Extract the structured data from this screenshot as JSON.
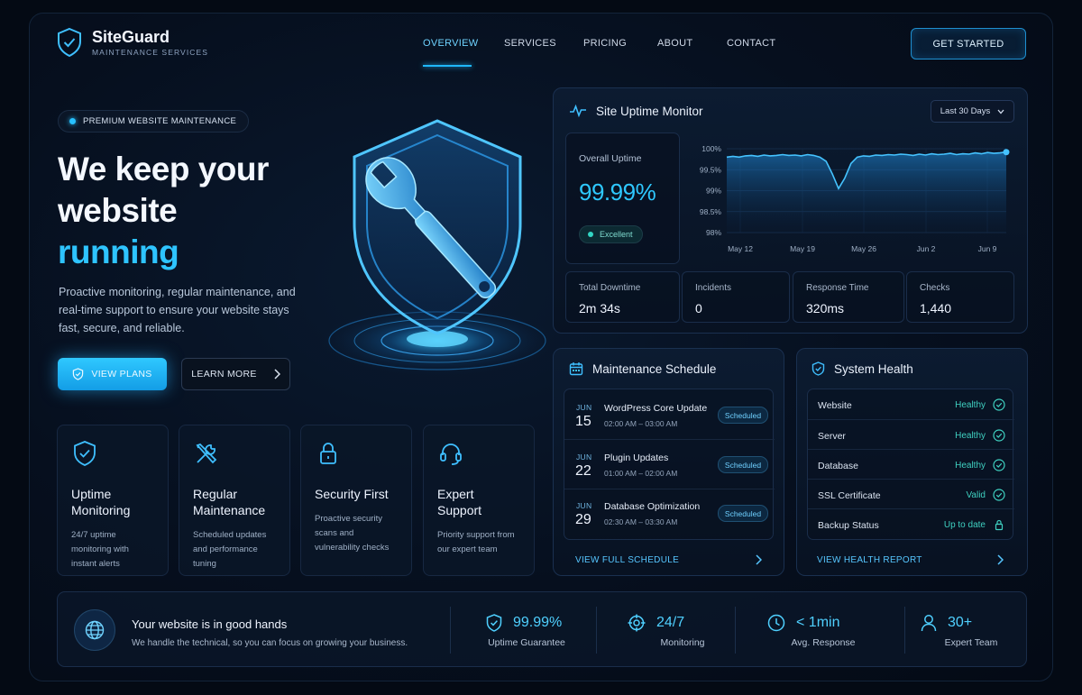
{
  "brand": {
    "name": "SiteGuard",
    "tagline": "MAINTENANCE SERVICES"
  },
  "nav": {
    "items": [
      "OVERVIEW",
      "SERVICES",
      "PRICING",
      "ABOUT",
      "CONTACT"
    ],
    "active": "OVERVIEW",
    "cta": "GET STARTED"
  },
  "hero": {
    "pill": "PREMIUM WEBSITE MAINTENANCE",
    "headline_line1": "We keep your",
    "headline_line2": "website",
    "headline_accent": "running",
    "description": "Proactive monitoring, regular maintenance, and real-time support to ensure your website stays fast, secure, and reliable.",
    "primary_button": "VIEW PLANS",
    "secondary_button": "LEARN MORE"
  },
  "features": [
    {
      "icon": "shield-check-icon",
      "title": "Uptime Monitoring",
      "desc": "24/7 uptime monitoring with instant alerts"
    },
    {
      "icon": "tools-icon",
      "title": "Regular Maintenance",
      "desc": "Scheduled updates and performance tuning"
    },
    {
      "icon": "lock-icon",
      "title": "Security First",
      "desc": "Proactive security scans and vulnerability checks"
    },
    {
      "icon": "headset-icon",
      "title": "Expert Support",
      "desc": "Priority support from our expert team"
    }
  ],
  "uptime": {
    "title": "Site Uptime Monitor",
    "range": "Last 30 Days",
    "overall_label": "Overall Uptime",
    "overall_value": "99.99%",
    "status": "Excellent",
    "stats": [
      {
        "label": "Total Downtime",
        "value": "2m 34s"
      },
      {
        "label": "Incidents",
        "value": "0"
      },
      {
        "label": "Response Time",
        "value": "320ms"
      },
      {
        "label": "Checks",
        "value": "1,440"
      }
    ]
  },
  "chart_data": {
    "type": "area",
    "title": "",
    "xlabel": "",
    "ylabel": "",
    "y_ticks": [
      "100%",
      "99.5%",
      "99%",
      "98.5%",
      "98%"
    ],
    "x_ticks": [
      "May 12",
      "May 19",
      "May 26",
      "Jun 2",
      "Jun 9"
    ],
    "ylim": [
      98,
      100
    ],
    "x": [
      0,
      1,
      2,
      3,
      4,
      5,
      6,
      7,
      8,
      9,
      10,
      11,
      12,
      13,
      14,
      15,
      16,
      17,
      18,
      19,
      20,
      21,
      22,
      23,
      24,
      25,
      26,
      27,
      28,
      29,
      30,
      31,
      32,
      33,
      34,
      35,
      36,
      37,
      38,
      39,
      40,
      41,
      42,
      43,
      44,
      45
    ],
    "values": [
      99.8,
      99.82,
      99.8,
      99.83,
      99.84,
      99.82,
      99.85,
      99.83,
      99.84,
      99.86,
      99.84,
      99.85,
      99.83,
      99.86,
      99.84,
      99.8,
      99.7,
      99.4,
      99.05,
      99.3,
      99.65,
      99.8,
      99.83,
      99.82,
      99.85,
      99.84,
      99.86,
      99.85,
      99.87,
      99.86,
      99.84,
      99.87,
      99.85,
      99.88,
      99.86,
      99.87,
      99.89,
      99.86,
      99.88,
      99.87,
      99.9,
      99.88,
      99.91,
      99.89,
      99.9,
      99.92
    ],
    "grid": true
  },
  "schedule": {
    "title": "Maintenance Schedule",
    "items": [
      {
        "month": "JUN",
        "day": "15",
        "title": "WordPress Core Update",
        "time": "02:00 AM – 03:00 AM",
        "status": "Scheduled"
      },
      {
        "month": "JUN",
        "day": "22",
        "title": "Plugin Updates",
        "time": "01:00 AM – 02:00 AM",
        "status": "Scheduled"
      },
      {
        "month": "JUN",
        "day": "29",
        "title": "Database Optimization",
        "time": "02:30 AM – 03:30 AM",
        "status": "Scheduled"
      }
    ],
    "link": "VIEW FULL SCHEDULE"
  },
  "health": {
    "title": "System Health",
    "items": [
      {
        "name": "Website",
        "status": "Healthy"
      },
      {
        "name": "Server",
        "status": "Healthy"
      },
      {
        "name": "Database",
        "status": "Healthy"
      },
      {
        "name": "SSL Certificate",
        "status": "Valid"
      },
      {
        "name": "Backup Status",
        "status": "Up to date"
      }
    ],
    "link": "VIEW HEALTH REPORT"
  },
  "footer": {
    "title": "Your website is in good hands",
    "subtitle": "We handle the technical, so you can focus on growing your business.",
    "stats": [
      {
        "icon": "shield-check-icon",
        "value": "99.99%",
        "label": "Uptime Guarantee"
      },
      {
        "icon": "crosshair-icon",
        "value": "24/7",
        "label": "Monitoring"
      },
      {
        "icon": "clock-icon",
        "value": "< 1min",
        "label": "Avg. Response"
      },
      {
        "icon": "user-icon",
        "value": "30+",
        "label": "Expert Team"
      }
    ]
  },
  "colors": {
    "accent": "#2ec4ff",
    "healthy": "#3fd1c1",
    "background": "#040a14"
  }
}
